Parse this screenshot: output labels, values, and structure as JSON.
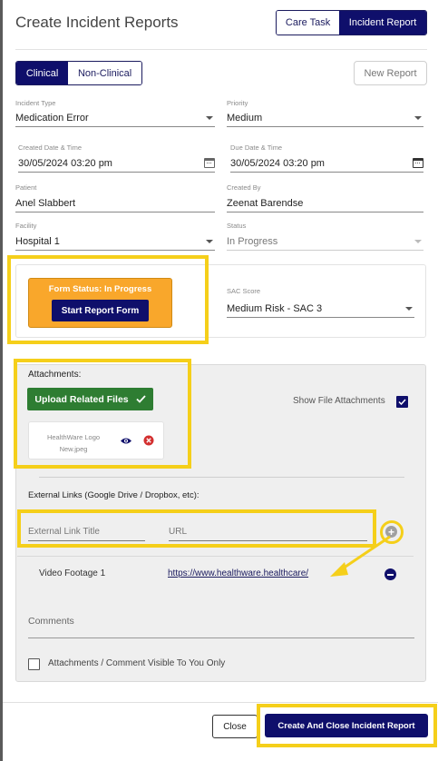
{
  "header": {
    "title": "Create Incident Reports",
    "tabs": [
      {
        "label": "Care Task",
        "active": false
      },
      {
        "label": "Incident Report",
        "active": true
      }
    ]
  },
  "category_tabs": [
    {
      "label": "Clinical",
      "active": true
    },
    {
      "label": "Non-Clinical",
      "active": false
    }
  ],
  "new_report_label": "New Report",
  "fields": {
    "incident_type": {
      "label": "Incident Type",
      "value": "Medication Error"
    },
    "priority": {
      "label": "Priority",
      "value": "Medium"
    },
    "created": {
      "label": "Created Date & Time",
      "value": "30/05/2024 03:20 pm"
    },
    "due": {
      "label": "Due Date & Time",
      "value": "30/05/2024  03:20 pm"
    },
    "patient": {
      "label": "Patient",
      "value": "Anel  Slabbert"
    },
    "created_by": {
      "label": "Created By",
      "value": "Zeenat Barendse"
    },
    "facility": {
      "label": "Facility",
      "value": "Hospital 1"
    },
    "status": {
      "label": "Status",
      "value": "In Progress"
    }
  },
  "form_status": {
    "text": "Form Status: In Progress",
    "start_button": "Start Report Form"
  },
  "sac": {
    "label": "SAC Score",
    "value": "Medium Risk - SAC 3"
  },
  "attachments": {
    "heading": "Attachments:",
    "upload_button": "Upload Related Files",
    "show_label": "Show File Attachments",
    "show_checked": true,
    "file": {
      "name_line1": "HealthWare Logo",
      "name_line2": "New.jpeg"
    }
  },
  "external_links": {
    "heading": "External Links (Google Drive / Dropbox, etc):",
    "title_placeholder": "External Link Title",
    "url_placeholder": "URL",
    "items": [
      {
        "title": "Video Footage 1",
        "url": "https://www.healthware.healthcare/"
      }
    ]
  },
  "comments_placeholder": "Comments",
  "visibility_label": "Attachments / Comment Visible To You Only",
  "footer": {
    "close": "Close",
    "create_close": "Create And Close Incident Report"
  },
  "colors": {
    "primary": "#0f0f6b",
    "highlight": "#f5cf1a",
    "status_orange": "#f9a72b",
    "upload_green": "#2e7d32"
  }
}
